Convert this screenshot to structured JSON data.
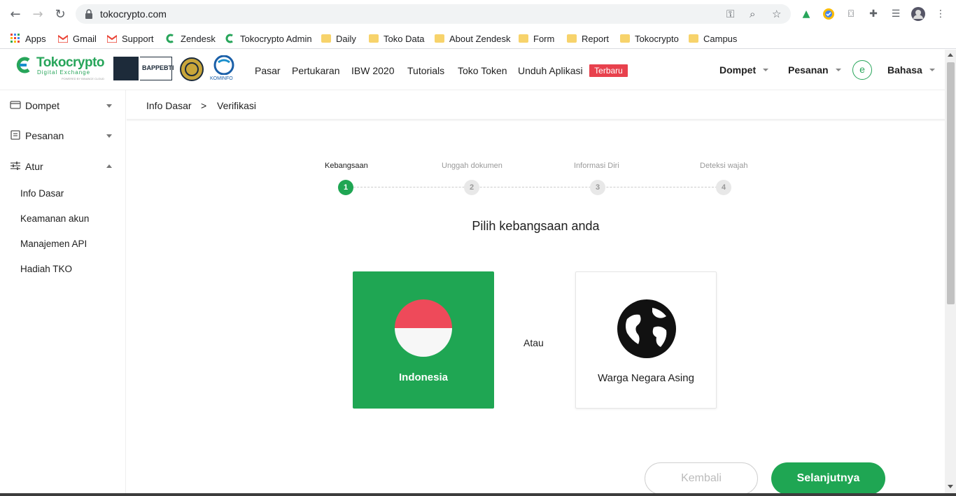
{
  "browser": {
    "url": "tokocrypto.com",
    "bookmarks": [
      {
        "label": "Apps",
        "icon": "apps-grid-icon"
      },
      {
        "label": "Gmail",
        "icon": "gmail-icon"
      },
      {
        "label": "Support",
        "icon": "gmail-icon"
      },
      {
        "label": "Zendesk",
        "icon": "tokocrypto-icon"
      },
      {
        "label": "Tokocrypto Admin",
        "icon": "tokocrypto-icon"
      },
      {
        "label": "Daily",
        "icon": "folder-icon"
      },
      {
        "label": "Toko Data",
        "icon": "folder-icon"
      },
      {
        "label": "About Zendesk",
        "icon": "folder-icon"
      },
      {
        "label": "Form",
        "icon": "folder-icon"
      },
      {
        "label": "Report",
        "icon": "folder-icon"
      },
      {
        "label": "Tokocrypto",
        "icon": "folder-icon"
      },
      {
        "label": "Campus",
        "icon": "folder-icon"
      }
    ]
  },
  "header": {
    "brand": "Tokocrypto",
    "brand_sub": "Digital Exchange",
    "brand_tiny": "POWERED BY BINANCE CLOUD",
    "reg_label": "BAPPEBTI",
    "kominfo": "KOMINFO",
    "nav": [
      "Pasar",
      "Pertukaran",
      "IBW 2020",
      "Tutorials",
      "Toko Token",
      "Unduh Aplikasi"
    ],
    "new_badge": "Terbaru",
    "wallet": "Dompet",
    "orders": "Pesanan",
    "avatar_letter": "e",
    "language": "Bahasa"
  },
  "sidebar": {
    "items": [
      {
        "label": "Dompet",
        "icon": "wallet-icon"
      },
      {
        "label": "Pesanan",
        "icon": "orders-list-icon"
      },
      {
        "label": "Atur",
        "icon": "sliders-icon"
      }
    ],
    "subitems": [
      "Info Dasar",
      "Keamanan akun",
      "Manajemen API",
      "Hadiah TKO"
    ]
  },
  "breadcrumb": {
    "parent": "Info Dasar",
    "separator": ">",
    "current": "Verifikasi"
  },
  "steps": [
    {
      "label": "Kebangsaan",
      "num": "1",
      "active": true
    },
    {
      "label": "Unggah dokumen",
      "num": "2",
      "active": false
    },
    {
      "label": "Informasi Diri",
      "num": "3",
      "active": false
    },
    {
      "label": "Deteksi wajah",
      "num": "4",
      "active": false
    }
  ],
  "form": {
    "heading": "Pilih kebangsaan anda",
    "option_local": "Indonesia",
    "separator": "Atau",
    "option_foreign": "Warga Negara Asing",
    "back_button": "Kembali",
    "next_button": "Selanjutnya"
  },
  "colors": {
    "accent": "#1fa653",
    "badge": "#e8414d",
    "flag_red": "#ee4a5a"
  }
}
